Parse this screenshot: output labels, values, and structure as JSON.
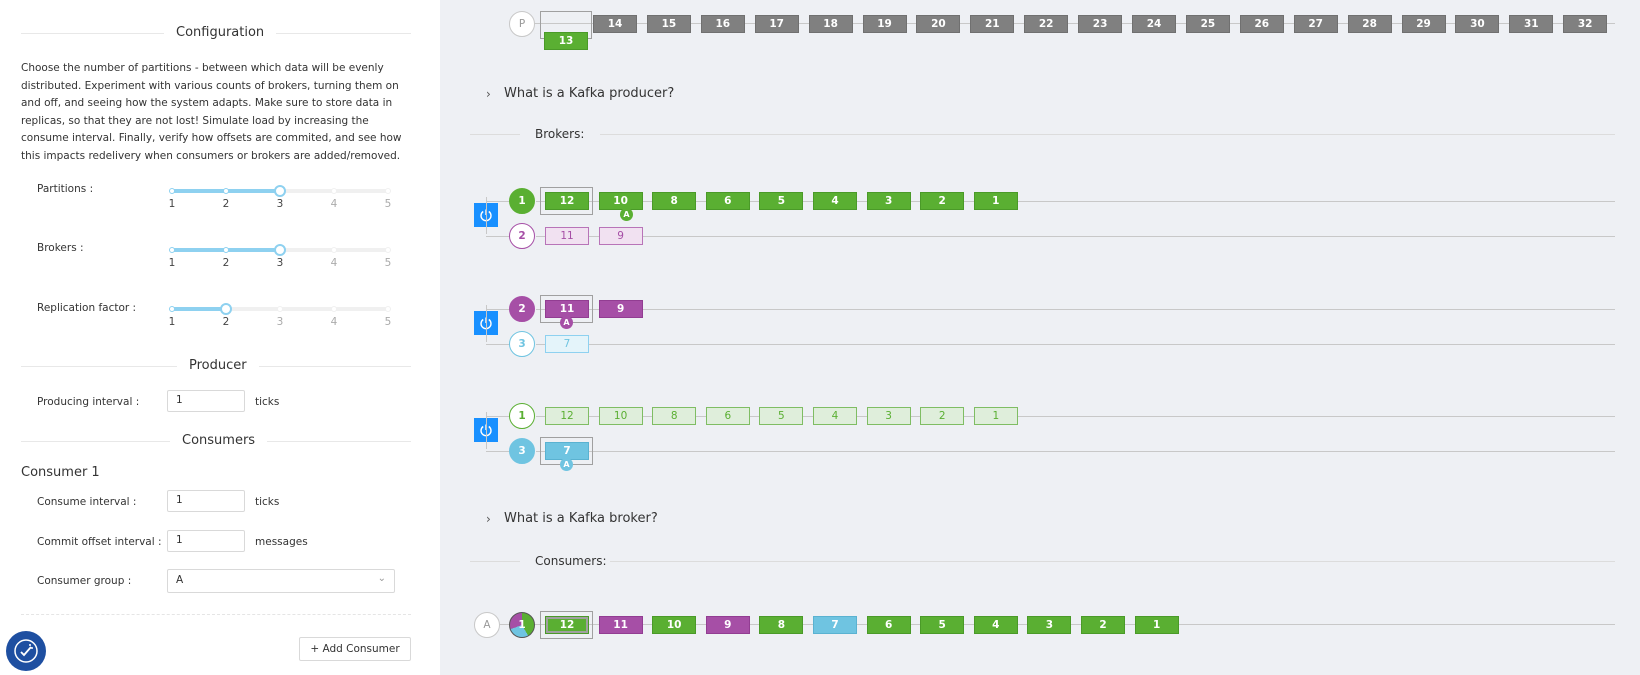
{
  "config": {
    "title": "Configuration",
    "description": "Choose the number of partitions - between which data will be evenly distributed. Experiment with various counts of brokers, turning them on and off, and seeing how the system adapts. Make sure to store data in replicas, so that they are not lost! Simulate load by increasing the consume interval. Finally, verify how offsets are commited, and see how this impacts redelivery when consumers or brokers are added/removed.",
    "partitions_label": "Partitions :",
    "partitions_value": 3,
    "brokers_label": "Brokers :",
    "brokers_value": 3,
    "replication_label": "Replication factor :",
    "replication_value": 2,
    "slider_marks": [
      "1",
      "2",
      "3",
      "4",
      "5"
    ],
    "slider_color": "#8ed1f0"
  },
  "producer": {
    "title": "Producer",
    "interval_label": "Producing interval :",
    "interval_value": "1",
    "interval_unit": "ticks"
  },
  "consumers": {
    "title": "Consumers",
    "consumer_title": "Consumer 1",
    "consume_label": "Consume interval :",
    "consume_value": "1",
    "consume_unit": "ticks",
    "commit_label": "Commit offset interval :",
    "commit_value": "1",
    "commit_unit": "messages",
    "group_label": "Consumer group :",
    "group_value": "A",
    "add_button": "+ Add Consumer"
  },
  "colors": {
    "green": "#5aaf32",
    "purple": "#a64fa6",
    "blue": "#6fc4e1",
    "gray": "#808080",
    "power": "#1890ff",
    "accessibility": "#1e4fa1"
  },
  "producer_lane": {
    "badge": "P",
    "messages": [
      "14",
      "15",
      "16",
      "17",
      "18",
      "19",
      "20",
      "21",
      "22",
      "23",
      "24",
      "25",
      "26",
      "27",
      "28",
      "29",
      "30",
      "31",
      "32"
    ],
    "current": "13"
  },
  "faq": {
    "producer": "What is a Kafka producer?",
    "broker": "What is a Kafka broker?"
  },
  "brokers_title": "Brokers:",
  "consumers_title": "Consumers:",
  "brokers": [
    {
      "rows": [
        {
          "partition": "1",
          "leader": true,
          "color": "green",
          "messages": [
            "12",
            "10",
            "8",
            "6",
            "5",
            "4",
            "3",
            "2",
            "1"
          ],
          "pin": "A"
        },
        {
          "partition": "2",
          "leader": false,
          "color": "purple",
          "messages": [
            "11",
            "9"
          ]
        }
      ]
    },
    {
      "rows": [
        {
          "partition": "2",
          "leader": true,
          "color": "purple",
          "messages": [
            "11",
            "9"
          ],
          "pin": "A"
        },
        {
          "partition": "3",
          "leader": false,
          "color": "blue",
          "messages": [
            "7"
          ]
        }
      ]
    },
    {
      "rows": [
        {
          "partition": "1",
          "leader": false,
          "color": "green",
          "messages": [
            "12",
            "10",
            "8",
            "6",
            "5",
            "4",
            "3",
            "2",
            "1"
          ]
        },
        {
          "partition": "3",
          "leader": true,
          "color": "blue",
          "messages": [
            "7"
          ],
          "pin": "A"
        }
      ]
    }
  ],
  "consumer_lane": {
    "badge": "A",
    "circle_label": "1",
    "messages": [
      {
        "v": "12",
        "c": "green"
      },
      {
        "v": "11",
        "c": "purple"
      },
      {
        "v": "10",
        "c": "green"
      },
      {
        "v": "9",
        "c": "purple"
      },
      {
        "v": "8",
        "c": "green"
      },
      {
        "v": "7",
        "c": "blue"
      },
      {
        "v": "6",
        "c": "green"
      },
      {
        "v": "5",
        "c": "green"
      },
      {
        "v": "4",
        "c": "green"
      },
      {
        "v": "3",
        "c": "green"
      },
      {
        "v": "2",
        "c": "green"
      },
      {
        "v": "1",
        "c": "green"
      }
    ]
  }
}
